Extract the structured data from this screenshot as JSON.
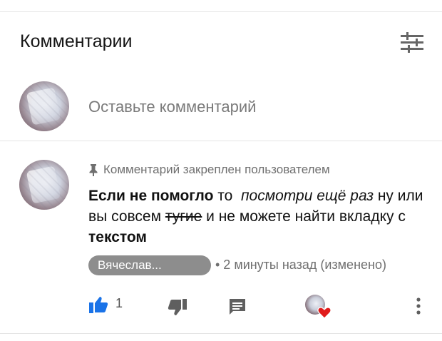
{
  "header": {
    "title": "Комментарии",
    "sort_icon": "sort-sliders-icon"
  },
  "composer": {
    "placeholder": "Оставьте комментарий"
  },
  "comment": {
    "pinned_label": "Комментарий закреплен пользователем",
    "text": {
      "part1": "Если не помогло",
      "part2": " то  ",
      "part3": "посмотри ещё раз",
      "part4": " ну или вы совсем ",
      "part5": "тугие",
      "part6": " и не можете найти вкладку с ",
      "part7": "текстом"
    },
    "author": "Вячеслав...",
    "meta": "• 2 минуты назад (изменено)",
    "likes": "1"
  },
  "colors": {
    "like_active": "#1a73e8",
    "heart": "#e01b1b",
    "chip_bg": "#8d8d8d"
  }
}
